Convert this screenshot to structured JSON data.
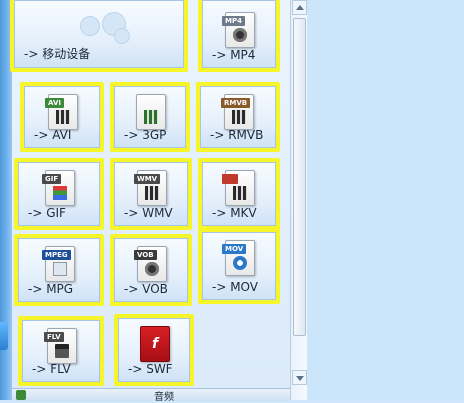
{
  "tiles": [
    {
      "label": "-> 移动设备",
      "icon": "mobile-device-icon"
    },
    {
      "label": "-> MP4",
      "tag": "MP4",
      "tag_color": "#6c7a8c",
      "icon": "mp4-file-icon"
    },
    {
      "label": "-> AVI",
      "tag": "AVI",
      "tag_color": "#3a8a3a",
      "icon": "avi-file-icon"
    },
    {
      "label": "-> 3GP",
      "tag": "",
      "tag_color": "#3a8a3a",
      "icon": "3gp-file-icon"
    },
    {
      "label": "-> RMVB",
      "tag": "RMVB",
      "tag_color": "#8a5a2a",
      "icon": "rmvb-file-icon"
    },
    {
      "label": "-> GIF",
      "tag": "GIF",
      "tag_color": "#4a4a4a",
      "icon": "gif-file-icon"
    },
    {
      "label": "-> WMV",
      "tag": "WMV",
      "tag_color": "#4a4a4a",
      "icon": "wmv-file-icon"
    },
    {
      "label": "-> MKV",
      "tag": "",
      "tag_color": "#c0392b",
      "icon": "mkv-file-icon"
    },
    {
      "label": "-> MPG",
      "tag": "MPEG",
      "tag_color": "#1f4f9a",
      "icon": "mpg-file-icon"
    },
    {
      "label": "-> VOB",
      "tag": "VOB",
      "tag_color": "#3a3a3a",
      "icon": "vob-file-icon"
    },
    {
      "label": "-> MOV",
      "tag": "MOV",
      "tag_color": "#2a79c8",
      "icon": "mov-file-icon"
    },
    {
      "label": "-> FLV",
      "tag": "FLV",
      "tag_color": "#4a4a4a",
      "icon": "flv-file-icon"
    },
    {
      "label": "-> SWF",
      "tag": "",
      "tag_color": "#c0161c",
      "icon": "swf-file-icon"
    }
  ],
  "bottom_bar": {
    "label": "音频",
    "icon": "audio-icon"
  },
  "colors": {
    "highlight": "#f5f52a",
    "accent": "#4f98d8"
  }
}
